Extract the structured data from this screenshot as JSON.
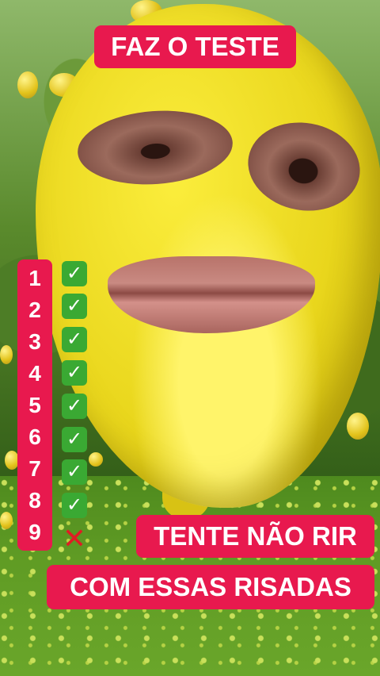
{
  "title": "FAZ O TESTE",
  "cta_line_1": "TENTE NÃO RIR",
  "cta_line_2": "COM ESSAS RISADAS",
  "accent_color": "#e8194e",
  "checklist": [
    {
      "number": "1",
      "status": "check",
      "icon": "check-mark-button-icon"
    },
    {
      "number": "2",
      "status": "check",
      "icon": "check-mark-button-icon"
    },
    {
      "number": "3",
      "status": "check",
      "icon": "check-mark-button-icon"
    },
    {
      "number": "4",
      "status": "check",
      "icon": "check-mark-button-icon"
    },
    {
      "number": "5",
      "status": "check",
      "icon": "check-mark-button-icon"
    },
    {
      "number": "6",
      "status": "check",
      "icon": "check-mark-button-icon"
    },
    {
      "number": "7",
      "status": "check",
      "icon": "check-mark-button-icon"
    },
    {
      "number": "8",
      "status": "check",
      "icon": "check-mark-button-icon"
    },
    {
      "number": "9",
      "status": "cross",
      "icon": "cross-mark-icon"
    }
  ],
  "glyphs": {
    "check": "✓",
    "cross": "✕"
  }
}
